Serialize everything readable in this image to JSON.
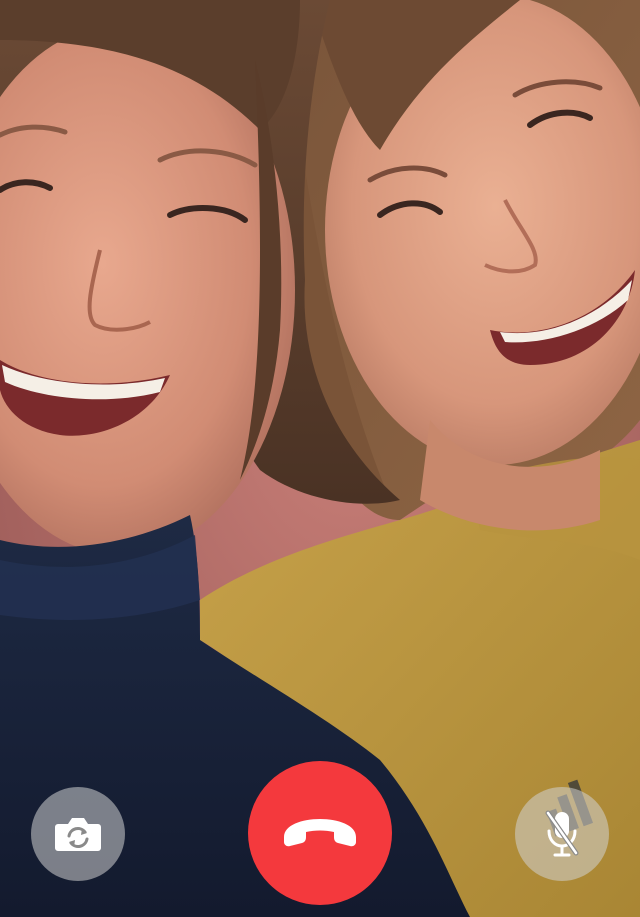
{
  "call": {
    "video_feed": "remote-video",
    "controls": [
      {
        "name": "flip-camera",
        "icon": "camera-flip-icon",
        "color": "#d2d2d2"
      },
      {
        "name": "end-call",
        "icon": "phone-hangup-icon",
        "color": "#f4393d"
      },
      {
        "name": "mute",
        "icon": "microphone-muted-icon",
        "color": "#d2d2d2"
      }
    ]
  },
  "colors": {
    "end_call": "#f4393d",
    "control_overlay": "#d2d2d2",
    "icon": "#ffffff"
  }
}
